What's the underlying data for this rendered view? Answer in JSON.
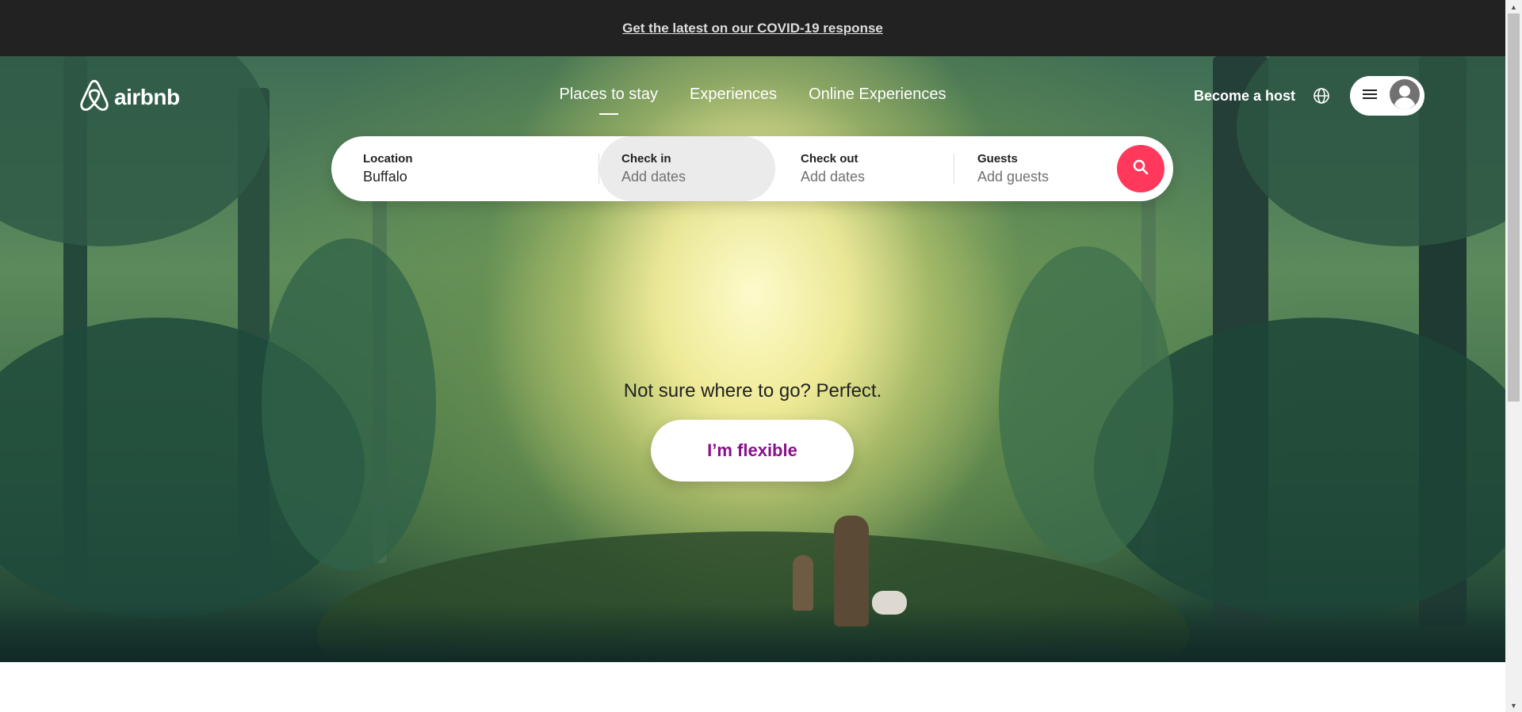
{
  "banner": {
    "link_text": "Get the latest on our COVID-19 response"
  },
  "header": {
    "logo_text": "airbnb",
    "nav": [
      {
        "label": "Places to stay",
        "active": true
      },
      {
        "label": "Experiences",
        "active": false
      },
      {
        "label": "Online Experiences",
        "active": false
      }
    ],
    "host_label": "Become a host",
    "icons": {
      "language": "globe-icon",
      "menu": "hamburger-icon",
      "profile": "user-avatar-icon"
    }
  },
  "search": {
    "location_label": "Location",
    "location_value": "Buffalo",
    "checkin_label": "Check in",
    "checkin_placeholder": "Add dates",
    "checkout_label": "Check out",
    "checkout_placeholder": "Add dates",
    "guests_label": "Guests",
    "guests_placeholder": "Add guests",
    "button_icon": "search-icon"
  },
  "hero": {
    "tagline": "Not sure where to go? Perfect.",
    "cta_label": "I’m flexible"
  },
  "colors": {
    "brand": "#ff385c",
    "cta_text": "#8b0e8c",
    "banner_bg": "#222222"
  }
}
